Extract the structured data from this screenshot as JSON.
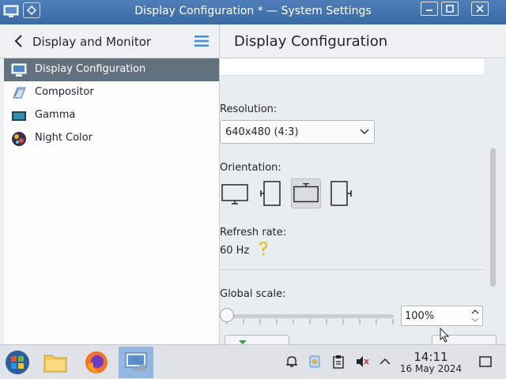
{
  "window": {
    "title": "Display Configuration * — System Settings"
  },
  "left": {
    "title": "Display and Monitor",
    "items": [
      {
        "label": "Display Configuration",
        "icon": "display-icon"
      },
      {
        "label": "Compositor",
        "icon": "compositor-icon"
      },
      {
        "label": "Gamma",
        "icon": "gamma-icon"
      },
      {
        "label": "Night Color",
        "icon": "night-color-icon"
      }
    ]
  },
  "right": {
    "title": "Display Configuration",
    "resolution_label": "Resolution:",
    "resolution_value": "640x480 (4:3)",
    "orientation_label": "Orientation:",
    "refresh_label": "Refresh rate:",
    "refresh_value": "60 Hz",
    "scale_label": "Global scale:",
    "scale_value": "100%",
    "scale_fraction": 0.0
  },
  "taskbar": {
    "time": "14:11",
    "date": "16 May 2024"
  },
  "colors": {
    "titlebar": "#3f70ab",
    "selected": "#62717e",
    "taskbar_active": "#93b7e0"
  }
}
